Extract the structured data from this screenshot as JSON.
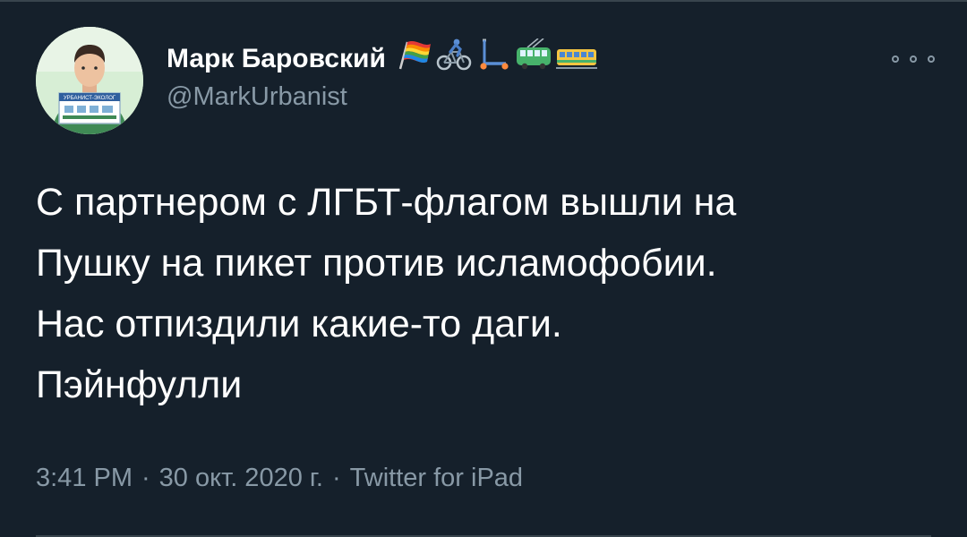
{
  "author": {
    "display_name": "Марк Баровский",
    "handle": "@MarkUrbanist",
    "name_emoji": [
      "rainbow-flag",
      "cyclist",
      "kick-scooter",
      "trolleybus",
      "tram"
    ],
    "avatar_badge_text": "УРБАНИСТ-ЭКОЛОГ"
  },
  "tweet": {
    "lines": [
      "С партнером с ЛГБТ-флагом вышли на",
      "Пушку на пикет против исламофобии.",
      "Нас отпиздили какие-то даги.",
      "Пэйнфулли"
    ]
  },
  "meta": {
    "time": "3:41 PM",
    "date": "30 окт. 2020 г.",
    "source": "Twitter for iPad",
    "separator": "·"
  },
  "menu": {
    "icon": "more-options-icon"
  },
  "colors": {
    "background": "#15202b",
    "text_primary": "#ffffff",
    "text_secondary": "#8899a6",
    "divider": "#38444d"
  }
}
